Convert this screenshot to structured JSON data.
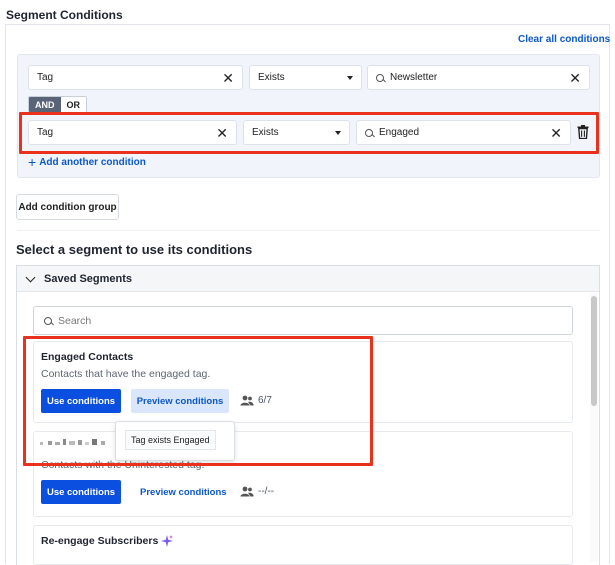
{
  "section_title": "Segment Conditions",
  "clear_all": "Clear all conditions",
  "condition_rows": [
    {
      "field": "Tag",
      "operator": "Exists",
      "value": "Newsletter"
    },
    {
      "field": "Tag",
      "operator": "Exists",
      "value": "Engaged"
    }
  ],
  "logic_toggle": {
    "and": "AND",
    "or": "OR",
    "selected": "AND"
  },
  "add_another": "Add another condition",
  "add_group": "Add condition group",
  "select_heading": "Select a segment to use its conditions",
  "saved_segments": {
    "header": "Saved Segments",
    "search_placeholder": "Search",
    "cards": [
      {
        "title": "Engaged Contacts",
        "description": "Contacts that have the engaged tag.",
        "use_label": "Use conditions",
        "preview_label": "Preview conditions",
        "count": "6/7"
      },
      {
        "title": "",
        "description": "Contacts with the Uninterested tag.",
        "use_label": "Use conditions",
        "preview_label": "Preview conditions",
        "count": "--/--"
      },
      {
        "title": "Re-engage Subscribers"
      }
    ]
  },
  "tooltip": {
    "text": "Tag exists Engaged"
  },
  "colors": {
    "accent": "#0b58c9",
    "primary_button": "#0a4fe0",
    "highlight": "#e8321e",
    "sparkle": "#7b5cf0"
  }
}
